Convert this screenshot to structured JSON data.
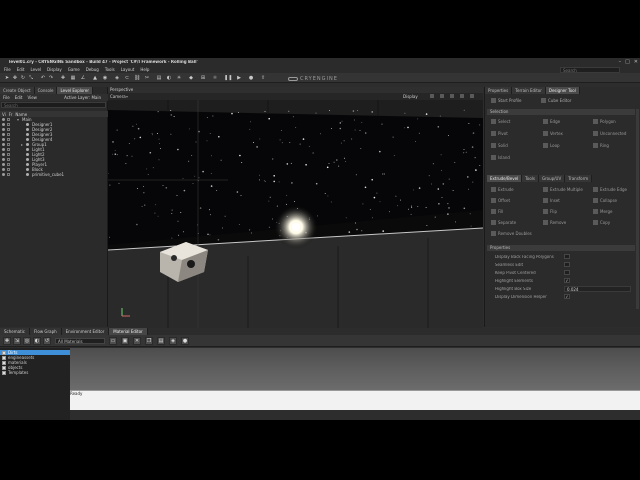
{
  "app": {
    "title": "level01.cry - CRYENGINE Sandbox - Build 47 - Project 'C#/I Framework - Rolling Ball'",
    "brand": "CRYENGINE",
    "window_buttons": [
      "–",
      "□",
      "✕"
    ],
    "search_placeholder": "Search"
  },
  "menu": [
    "File",
    "Edit",
    "Level",
    "Display",
    "Game",
    "Debug",
    "Tools",
    "Layout",
    "Help"
  ],
  "left_panel": {
    "tabs": [
      "Create Object",
      "Console",
      "Level Explorer"
    ],
    "active_tab": "Level Explorer",
    "menu": [
      "File",
      "Edit",
      "View"
    ],
    "active_layer_label": "Active Layer: Main",
    "search_placeholder": "Search",
    "columns": [
      "Vi",
      "Fr",
      "Name"
    ],
    "tree": [
      {
        "label": "Main",
        "indent": 0
      },
      {
        "label": "Designer1",
        "indent": 1
      },
      {
        "label": "Designer2",
        "indent": 1
      },
      {
        "label": "Designer3",
        "indent": 1
      },
      {
        "label": "Designer4",
        "indent": 1
      },
      {
        "label": "Group1",
        "indent": 1
      },
      {
        "label": "Light1",
        "indent": 1
      },
      {
        "label": "Light2",
        "indent": 1
      },
      {
        "label": "Light3",
        "indent": 1
      },
      {
        "label": "Player1",
        "indent": 1
      },
      {
        "label": "Block",
        "indent": 1
      },
      {
        "label": "primitive_cube1",
        "indent": 1
      }
    ]
  },
  "viewport": {
    "title": "Perspective",
    "camera_label": "Camera",
    "display_label": "Display"
  },
  "right_panel": {
    "tabs": [
      "Properties",
      "Terrain Editor",
      "Designer Tool"
    ],
    "active_tab": "Designer Tool",
    "top_buttons": [
      "Start Profile",
      "Cube Editor"
    ],
    "selection_header": "Selection",
    "selection_buttons": [
      "Select",
      "Edge",
      "Polygon",
      "Pivot",
      "Vertex",
      "Unconnected",
      "Solid",
      "Loop",
      "Ring",
      "Island"
    ],
    "shape_tabs": [
      "Extrude/Bevel",
      "Tools",
      "Group/UV",
      "Transform"
    ],
    "active_shape_tab": "Extrude/Bevel",
    "shape_buttons": [
      "Extrude",
      "Extrude Multiple",
      "Extrude Edge",
      "Offset",
      "Inset",
      "Collapse",
      "Fill",
      "Flip",
      "Merge",
      "Separate",
      "Remove",
      "Copy",
      "Remove Doubles"
    ],
    "properties_header": "Properties",
    "properties": [
      {
        "label": "Display Back Facing Polygons",
        "kind": "check",
        "checked": false
      },
      {
        "label": "Seamless Edit",
        "kind": "check",
        "checked": false
      },
      {
        "label": "Keep Pivot Centered",
        "kind": "check",
        "checked": false
      },
      {
        "label": "Highlight Elements",
        "kind": "check",
        "checked": true
      },
      {
        "label": "Highlight Box Size",
        "kind": "value",
        "value": "0.024"
      },
      {
        "label": "Display Dimension Helper",
        "kind": "check",
        "checked": true
      }
    ]
  },
  "bottom": {
    "tabs": [
      "Schematic",
      "Flow Graph",
      "Environment Editor",
      "Material Editor"
    ],
    "active_tab": "Material Editor",
    "filter_value": "All Materials",
    "tree": [
      {
        "label": "Dirts",
        "selected": true
      },
      {
        "label": "engineassets",
        "selected": false
      },
      {
        "label": "materials",
        "selected": false
      },
      {
        "label": "objects",
        "selected": false
      },
      {
        "label": "Templates",
        "selected": false
      }
    ],
    "status": "Ready"
  },
  "colors": {
    "selection": "#3e8fd8",
    "panel": "#2d2d2d",
    "sky": "#050505"
  }
}
